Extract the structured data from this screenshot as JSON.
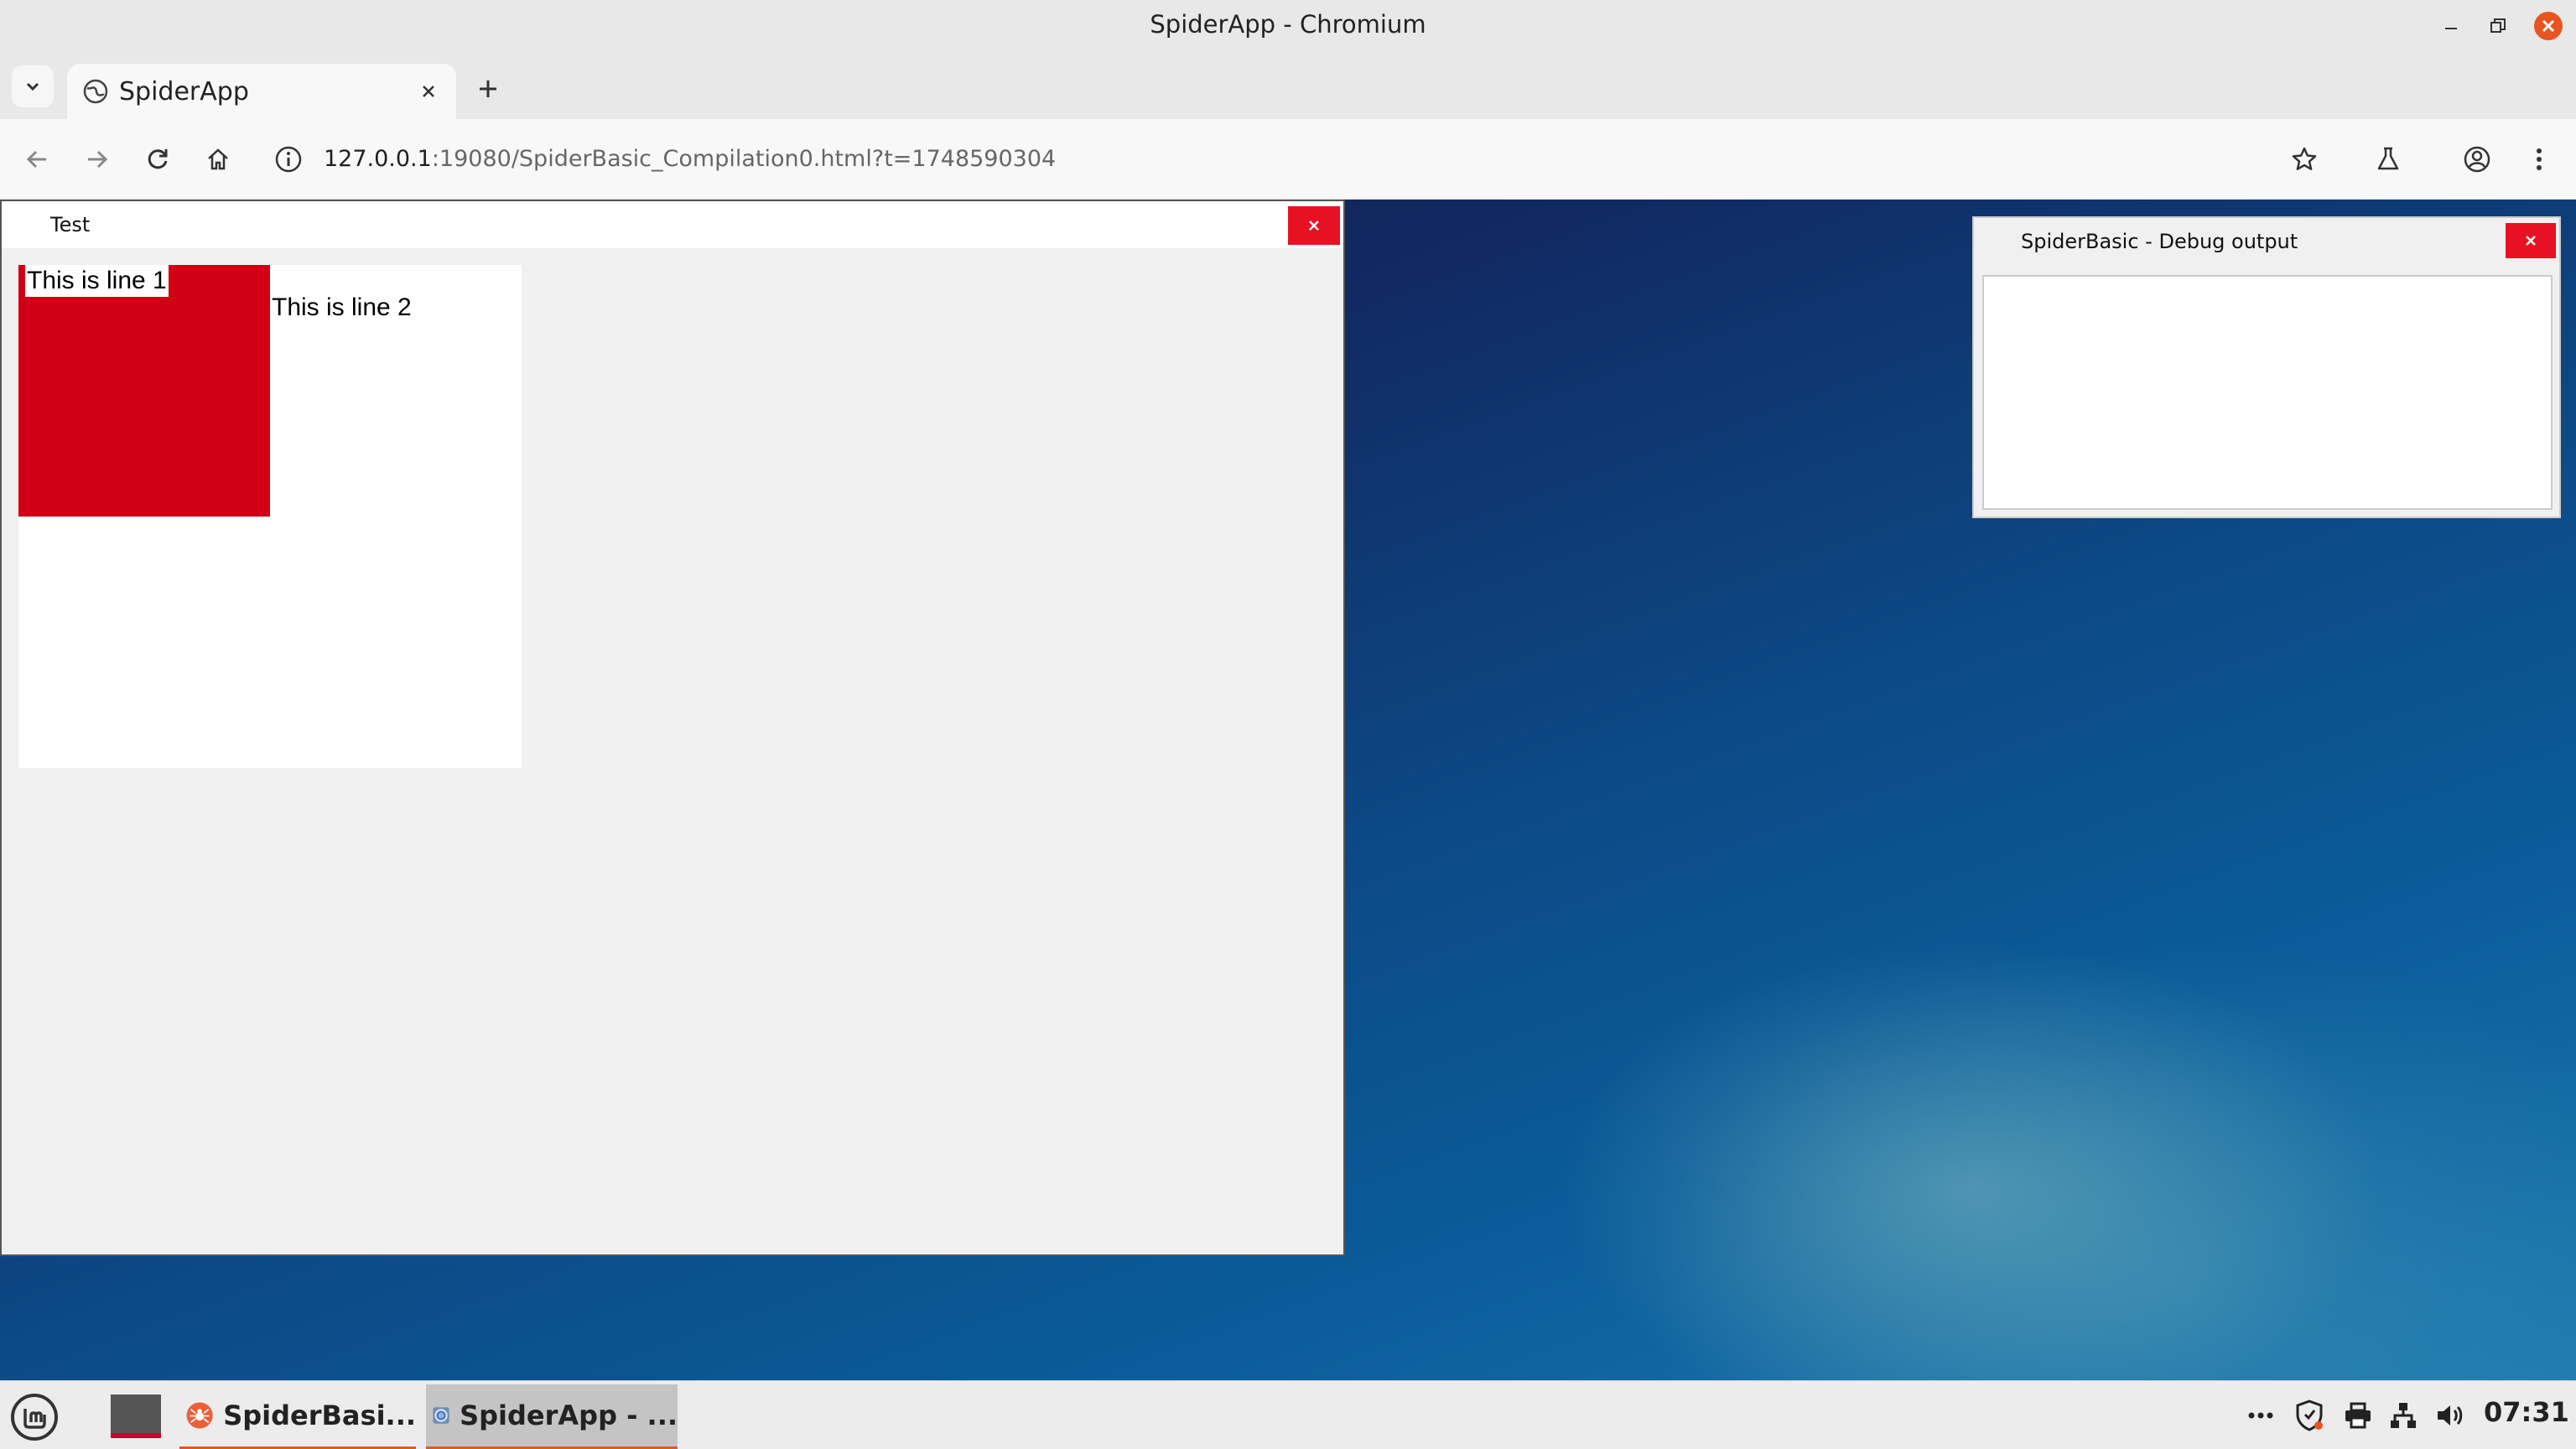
{
  "window_title": "SpiderApp - Chromium",
  "tab": {
    "title": "SpiderApp"
  },
  "address_bar": {
    "host": "127.0.0.1",
    "rest": ":19080/SpiderBasic_Compilation0.html?t=1748590304"
  },
  "app": {
    "test_window": {
      "title": "Test",
      "line1": "This is line 1",
      "line2": "This is line 2"
    },
    "debug_window": {
      "title": "SpiderBasic - Debug output"
    }
  },
  "taskbar": {
    "tasks": [
      {
        "label": "SpiderBasi..."
      },
      {
        "label": "SpiderApp - ..."
      }
    ],
    "clock": "07:31"
  },
  "colors": {
    "accent": "#e95420",
    "close_red": "#e81123",
    "box_red": "#d10014"
  }
}
